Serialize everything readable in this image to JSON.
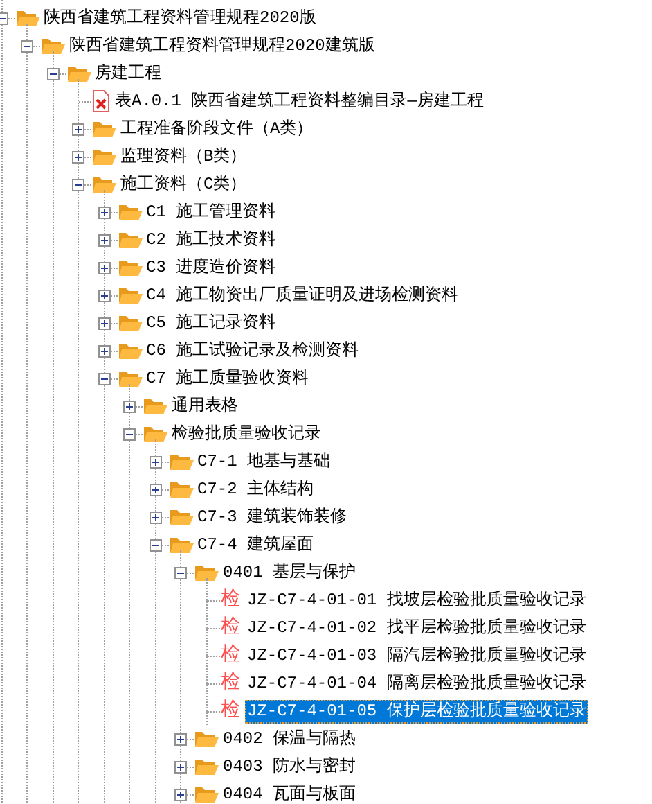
{
  "tree": [
    {
      "label": "陕西省建筑工程资料管理规程2020版",
      "kind": "folder",
      "expanded": true,
      "selected": false,
      "children": [
        {
          "label": "陕西省建筑工程资料管理规程2020建筑版",
          "kind": "folder",
          "expanded": true,
          "selected": false,
          "children": [
            {
              "label": "房建工程",
              "kind": "folder",
              "expanded": true,
              "selected": false,
              "children": [
                {
                  "label": "表A.0.1 陕西省建筑工程资料整编目录—房建工程",
                  "kind": "document",
                  "selected": false
                },
                {
                  "label": "工程准备阶段文件（A类）",
                  "kind": "folder",
                  "expanded": false,
                  "selected": false
                },
                {
                  "label": "监理资料（B类）",
                  "kind": "folder",
                  "expanded": false,
                  "selected": false
                },
                {
                  "label": "施工资料（C类）",
                  "kind": "folder",
                  "expanded": true,
                  "selected": false,
                  "children": [
                    {
                      "label": "C1 施工管理资料",
                      "kind": "folder",
                      "expanded": false,
                      "selected": false
                    },
                    {
                      "label": "C2 施工技术资料",
                      "kind": "folder",
                      "expanded": false,
                      "selected": false
                    },
                    {
                      "label": "C3 进度造价资料",
                      "kind": "folder",
                      "expanded": false,
                      "selected": false
                    },
                    {
                      "label": "C4 施工物资出厂质量证明及进场检测资料",
                      "kind": "folder",
                      "expanded": false,
                      "selected": false
                    },
                    {
                      "label": "C5 施工记录资料",
                      "kind": "folder",
                      "expanded": false,
                      "selected": false
                    },
                    {
                      "label": "C6 施工试验记录及检测资料",
                      "kind": "folder",
                      "expanded": false,
                      "selected": false
                    },
                    {
                      "label": "C7 施工质量验收资料",
                      "kind": "folder",
                      "expanded": true,
                      "selected": false,
                      "children": [
                        {
                          "label": "通用表格",
                          "kind": "folder",
                          "expanded": false,
                          "selected": false
                        },
                        {
                          "label": "检验批质量验收记录",
                          "kind": "folder",
                          "expanded": true,
                          "selected": false,
                          "children": [
                            {
                              "label": "C7-1 地基与基础",
                              "kind": "folder",
                              "expanded": false,
                              "selected": false
                            },
                            {
                              "label": "C7-2 主体结构",
                              "kind": "folder",
                              "expanded": false,
                              "selected": false
                            },
                            {
                              "label": "C7-3 建筑装饰装修",
                              "kind": "folder",
                              "expanded": false,
                              "selected": false
                            },
                            {
                              "label": "C7-4 建筑屋面",
                              "kind": "folder",
                              "expanded": true,
                              "selected": false,
                              "children": [
                                {
                                  "label": "0401 基层与保护",
                                  "kind": "folder",
                                  "expanded": true,
                                  "selected": false,
                                  "children": [
                                    {
                                      "label": "JZ-C7-4-01-01 找坡层检验批质量验收记录",
                                      "kind": "form",
                                      "icon": "检",
                                      "selected": false
                                    },
                                    {
                                      "label": "JZ-C7-4-01-02 找平层检验批质量验收记录",
                                      "kind": "form",
                                      "icon": "检",
                                      "selected": false
                                    },
                                    {
                                      "label": "JZ-C7-4-01-03 隔汽层检验批质量验收记录",
                                      "kind": "form",
                                      "icon": "检",
                                      "selected": false
                                    },
                                    {
                                      "label": "JZ-C7-4-01-04 隔离层检验批质量验收记录",
                                      "kind": "form",
                                      "icon": "检",
                                      "selected": false
                                    },
                                    {
                                      "label": "JZ-C7-4-01-05 保护层检验批质量验收记录",
                                      "kind": "form",
                                      "icon": "检",
                                      "selected": true
                                    }
                                  ]
                                },
                                {
                                  "label": "0402 保温与隔热",
                                  "kind": "folder",
                                  "expanded": false,
                                  "selected": false
                                },
                                {
                                  "label": "0403 防水与密封",
                                  "kind": "folder",
                                  "expanded": false,
                                  "selected": false
                                },
                                {
                                  "label": "0404 瓦面与板面",
                                  "kind": "folder",
                                  "expanded": false,
                                  "selected": false
                                }
                              ]
                            }
                          ]
                        }
                      ]
                    }
                  ]
                }
              ]
            }
          ]
        }
      ]
    }
  ]
}
